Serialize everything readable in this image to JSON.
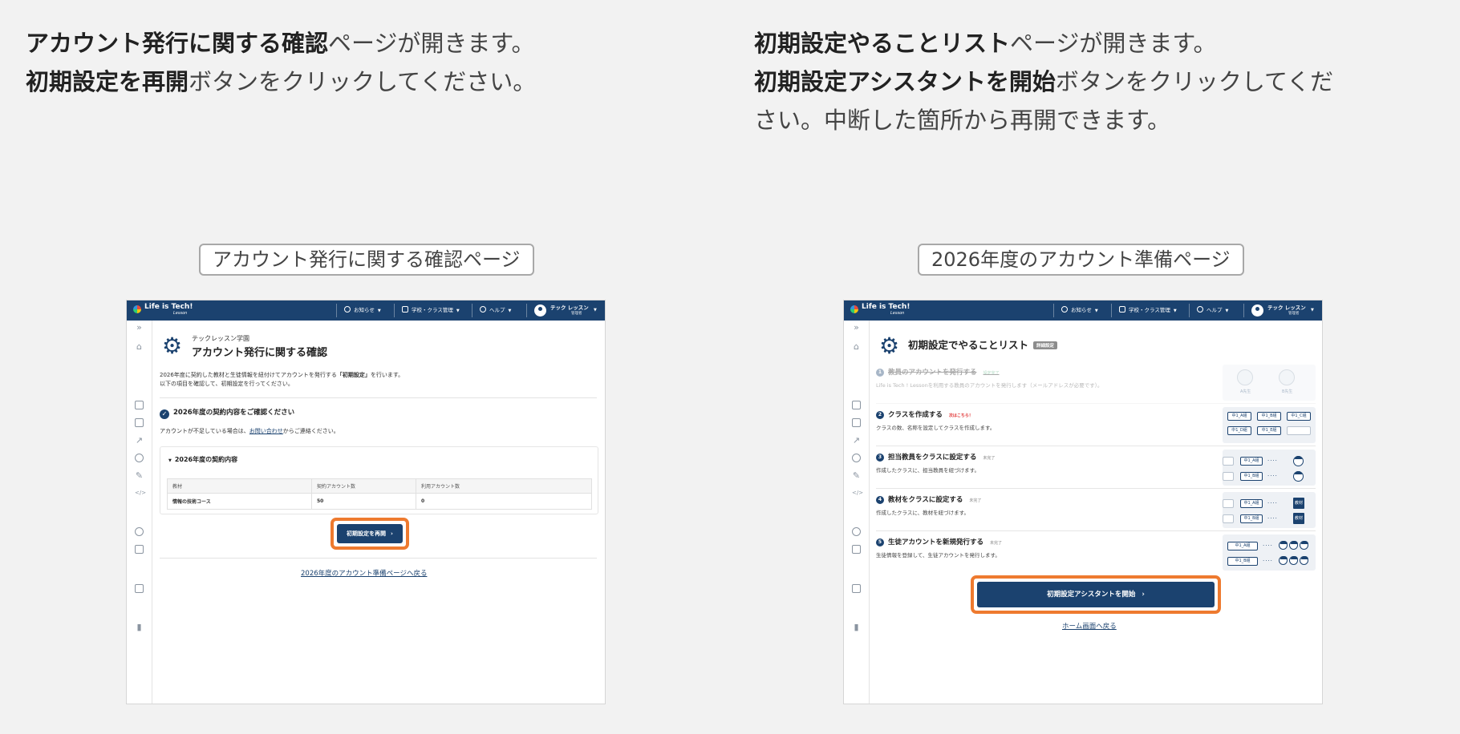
{
  "left_panel": {
    "instruction": {
      "line1_bold": "アカウント発行に関する確認",
      "line1_rest": "ページが開きます。",
      "line2_bold": "初期設定を再開",
      "line2_rest": "ボタンをクリックしてください。"
    },
    "caption": "アカウント発行に関する確認ページ",
    "screen": {
      "school_name": "テックレッスン学園",
      "page_title": "アカウント発行に関する確認",
      "intro_line1_a": "2026年度に契約した教材と生徒情報を紐付けてアカウントを発行する",
      "intro_line1_bold": "「初期設定」",
      "intro_line1_b": "を行います。",
      "intro_line2": "以下の項目を確認して、初期設定を行ってください。",
      "check_heading": "2026年度の契約内容をご確認ください",
      "shortage_a": "アカウントが不足している場合は、",
      "shortage_link": "お問い合わせ",
      "shortage_b": "からご連絡ください。",
      "accordion_title": "2026年度の契約内容",
      "table_headers": [
        "教材",
        "契約アカウント数",
        "利用アカウント数"
      ],
      "table_rows": [
        [
          "情報の技術コース",
          "50",
          "0"
        ]
      ],
      "resume_button": "初期設定を再開",
      "back_link": "2026年度のアカウント準備ページへ戻る"
    }
  },
  "right_panel": {
    "instruction": {
      "line1_bold": "初期設定やることリスト",
      "line1_rest": "ページが開きます。",
      "line2_bold": "初期設定アシスタントを開始",
      "line2_rest": "ボタンをクリックしてくだ",
      "line3": "さい。中断した箇所から再開できます。"
    },
    "caption": "2026年度のアカウント準備ページ",
    "screen": {
      "page_title": "初期設定でやることリスト",
      "detail_badge": "詳細設定",
      "steps": [
        {
          "num": "1",
          "title": "教員のアカウントを発行する",
          "status": "設定完了",
          "desc": "Life is Tech ! Lessonを利用する教員のアカウントを発行します（メールアドレスが必要です）。"
        },
        {
          "num": "2",
          "title": "クラスを作成する",
          "status": "次はこちら！",
          "desc": "クラスの数、名称を設定してクラスを作成します。"
        },
        {
          "num": "3",
          "title": "担当教員をクラスに設定する",
          "status": "未完了",
          "desc": "作成したクラスに、担当教員を紐づけます。"
        },
        {
          "num": "4",
          "title": "教材をクラスに設定する",
          "status": "未完了",
          "desc": "作成したクラスに、教材を紐づけます。"
        },
        {
          "num": "5",
          "title": "生徒アカウントを新規発行する",
          "status": "未完了",
          "desc": "生徒情報を登録して、生徒アカウントを発行します。"
        }
      ],
      "teachers": [
        "A先生",
        "B先生"
      ],
      "class_chips": [
        "中1_A組",
        "中1_B組",
        "中1_C組",
        "中1_D組",
        "中1_E組"
      ],
      "material_label": "教材",
      "start_button": "初期設定アシスタントを開始",
      "home_link": "ホーム画面へ戻る"
    }
  },
  "app": {
    "logo": "Life is Tech!",
    "logo_sub": "Lesson",
    "nav_news": "お知らせ",
    "nav_school": "学校・クラス管理",
    "nav_help": "ヘルプ",
    "user_name": "テック レッスン",
    "user_role": "管理者"
  },
  "colors": {
    "brand": "#1b426f",
    "highlight": "#ee7a2f"
  }
}
